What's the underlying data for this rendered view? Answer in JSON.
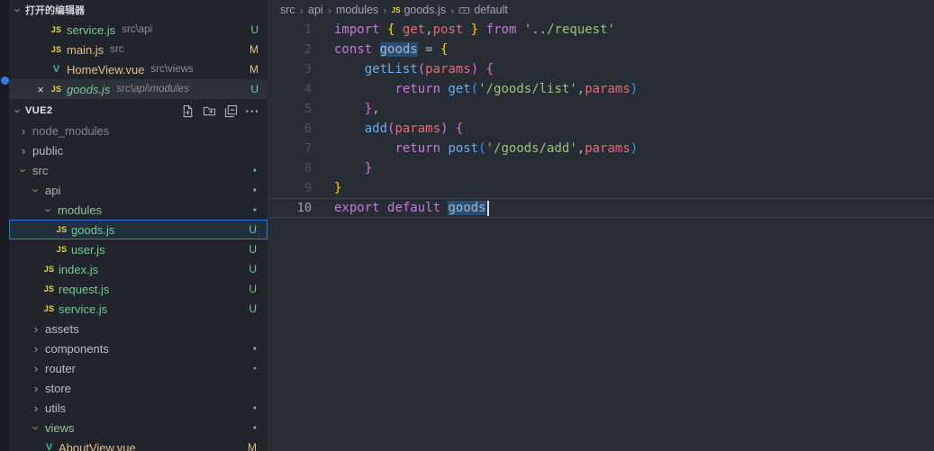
{
  "activity_bar": {
    "badge_color": "#2e7de9"
  },
  "sidebar": {
    "open_editors": {
      "title": "打开的编辑器",
      "items": [
        {
          "icon": "js",
          "name": "service.js",
          "desc": "src\\api",
          "badge": "U",
          "status": "untracked",
          "active": false,
          "preview": false
        },
        {
          "icon": "js",
          "name": "main.js",
          "desc": "src",
          "badge": "M",
          "status": "modified",
          "active": false,
          "preview": false
        },
        {
          "icon": "vue",
          "name": "HomeView.vue",
          "desc": "src\\views",
          "badge": "M",
          "status": "modified",
          "active": false,
          "preview": false
        },
        {
          "icon": "js",
          "name": "goods.js",
          "desc": "src\\api\\modules",
          "badge": "U",
          "status": "untracked",
          "active": true,
          "preview": true,
          "close_icon": "×"
        }
      ]
    },
    "explorer": {
      "title": "VUE2",
      "actions": [
        "new-file",
        "new-folder",
        "collapse-all",
        "more-actions"
      ],
      "more_glyph": "···",
      "items": [
        {
          "kind": "folder",
          "name": "node_modules",
          "level": 0,
          "expanded": false,
          "dim": true
        },
        {
          "kind": "folder",
          "name": "public",
          "level": 0,
          "expanded": false
        },
        {
          "kind": "folder",
          "name": "src",
          "level": 0,
          "expanded": true,
          "dot": "#73c991",
          "tint": true
        },
        {
          "kind": "folder",
          "name": "api",
          "level": 1,
          "expanded": true,
          "dot": "#73c991",
          "tint": true
        },
        {
          "kind": "folder",
          "name": "modules",
          "level": 2,
          "expanded": true,
          "dot": "#73c991",
          "tint": true
        },
        {
          "kind": "file",
          "icon": "js",
          "name": "goods.js",
          "level": 3,
          "badge": "U",
          "status": "untracked",
          "selected": true
        },
        {
          "kind": "file",
          "icon": "js",
          "name": "user.js",
          "level": 3,
          "badge": "U",
          "status": "untracked"
        },
        {
          "kind": "file",
          "icon": "js",
          "name": "index.js",
          "level": 2,
          "badge": "U",
          "status": "untracked"
        },
        {
          "kind": "file",
          "icon": "js",
          "name": "request.js",
          "level": 2,
          "badge": "U",
          "status": "untracked"
        },
        {
          "kind": "file",
          "icon": "js",
          "name": "service.js",
          "level": 2,
          "badge": "U",
          "status": "untracked"
        },
        {
          "kind": "folder",
          "name": "assets",
          "level": 1,
          "expanded": false
        },
        {
          "kind": "folder",
          "name": "components",
          "level": 1,
          "expanded": false,
          "dot": "#73c991"
        },
        {
          "kind": "folder",
          "name": "router",
          "level": 1,
          "expanded": false,
          "dot": "#8a919c"
        },
        {
          "kind": "folder",
          "name": "store",
          "level": 1,
          "expanded": false
        },
        {
          "kind": "folder",
          "name": "utils",
          "level": 1,
          "expanded": false,
          "dot": "#73c991"
        },
        {
          "kind": "folder",
          "name": "views",
          "level": 1,
          "expanded": true,
          "dot": "#73c991",
          "tint": true
        },
        {
          "kind": "file",
          "icon": "vue",
          "name": "AboutView.vue",
          "level": 2,
          "badge": "M",
          "status": "modified"
        }
      ]
    }
  },
  "breadcrumb": {
    "separator": "›",
    "items": [
      {
        "label": "src"
      },
      {
        "label": "api"
      },
      {
        "label": "modules"
      },
      {
        "label": "goods.js",
        "icon": "js"
      },
      {
        "label": "default",
        "icon": "symbol-variable"
      }
    ]
  },
  "editor": {
    "lines": [
      {
        "num": "1",
        "tokens": [
          {
            "t": "import",
            "c": "kw"
          },
          {
            "t": " ",
            "c": "tx"
          },
          {
            "t": "{",
            "c": "b1"
          },
          {
            "t": " ",
            "c": "tx"
          },
          {
            "t": "get",
            "c": "vr"
          },
          {
            "t": ",",
            "c": "tx"
          },
          {
            "t": "post",
            "c": "vr"
          },
          {
            "t": " ",
            "c": "tx"
          },
          {
            "t": "}",
            "c": "b1"
          },
          {
            "t": " ",
            "c": "tx"
          },
          {
            "t": "from",
            "c": "kw"
          },
          {
            "t": " ",
            "c": "tx"
          },
          {
            "t": "'../request'",
            "c": "str"
          }
        ]
      },
      {
        "num": "2",
        "tokens": [
          {
            "t": "const",
            "c": "kw"
          },
          {
            "t": " ",
            "c": "tx"
          },
          {
            "t": "goods",
            "c": "tx",
            "hl": true
          },
          {
            "t": " = ",
            "c": "tx"
          },
          {
            "t": "{",
            "c": "b1"
          }
        ]
      },
      {
        "num": "3",
        "tokens": [
          {
            "t": "    ",
            "c": "tx"
          },
          {
            "t": "getList",
            "c": "fn"
          },
          {
            "t": "(",
            "c": "b2"
          },
          {
            "t": "params",
            "c": "vr"
          },
          {
            "t": ")",
            "c": "b2"
          },
          {
            "t": " ",
            "c": "tx"
          },
          {
            "t": "{",
            "c": "b2"
          }
        ]
      },
      {
        "num": "4",
        "tokens": [
          {
            "t": "        ",
            "c": "tx"
          },
          {
            "t": "return",
            "c": "kw"
          },
          {
            "t": " ",
            "c": "tx"
          },
          {
            "t": "get",
            "c": "fn"
          },
          {
            "t": "(",
            "c": "b3"
          },
          {
            "t": "'/goods/list'",
            "c": "str"
          },
          {
            "t": ",",
            "c": "tx"
          },
          {
            "t": "params",
            "c": "vr"
          },
          {
            "t": ")",
            "c": "b3"
          }
        ]
      },
      {
        "num": "5",
        "tokens": [
          {
            "t": "    ",
            "c": "tx"
          },
          {
            "t": "}",
            "c": "b2"
          },
          {
            "t": ",",
            "c": "tx"
          }
        ]
      },
      {
        "num": "6",
        "tokens": [
          {
            "t": "    ",
            "c": "tx"
          },
          {
            "t": "add",
            "c": "fn"
          },
          {
            "t": "(",
            "c": "b2"
          },
          {
            "t": "params",
            "c": "vr"
          },
          {
            "t": ")",
            "c": "b2"
          },
          {
            "t": " ",
            "c": "tx"
          },
          {
            "t": "{",
            "c": "b2"
          }
        ]
      },
      {
        "num": "7",
        "tokens": [
          {
            "t": "        ",
            "c": "tx"
          },
          {
            "t": "return",
            "c": "kw"
          },
          {
            "t": " ",
            "c": "tx"
          },
          {
            "t": "post",
            "c": "fn"
          },
          {
            "t": "(",
            "c": "b3"
          },
          {
            "t": "'/goods/add'",
            "c": "str"
          },
          {
            "t": ",",
            "c": "tx"
          },
          {
            "t": "params",
            "c": "vr"
          },
          {
            "t": ")",
            "c": "b3"
          }
        ]
      },
      {
        "num": "8",
        "tokens": [
          {
            "t": "    ",
            "c": "tx"
          },
          {
            "t": "}",
            "c": "b2"
          }
        ]
      },
      {
        "num": "9",
        "tokens": [
          {
            "t": "}",
            "c": "b1"
          }
        ]
      },
      {
        "num": "10",
        "active": true,
        "tokens": [
          {
            "t": "export",
            "c": "kw"
          },
          {
            "t": " ",
            "c": "tx"
          },
          {
            "t": "default",
            "c": "kw"
          },
          {
            "t": " ",
            "c": "tx"
          },
          {
            "t": "goods",
            "c": "tx",
            "hl": true,
            "cursor": true
          }
        ]
      }
    ]
  }
}
